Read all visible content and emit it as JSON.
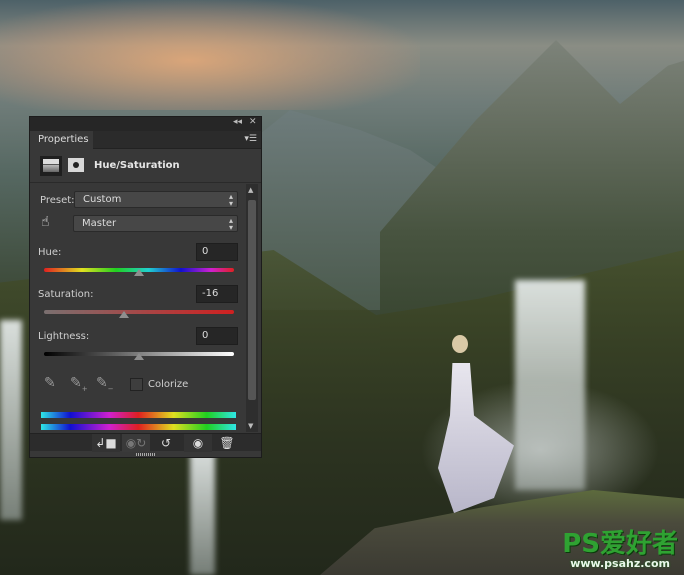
{
  "panel": {
    "tab_label": "Properties",
    "title": "Hue/Saturation",
    "preset_label": "Preset:",
    "preset_value": "Custom",
    "channel_value": "Master",
    "hue": {
      "label": "Hue:",
      "value": "0",
      "slider_fraction": 0.5
    },
    "saturation": {
      "label": "Saturation:",
      "value": "-16",
      "slider_fraction": 0.42
    },
    "lightness": {
      "label": "Lightness:",
      "value": "0",
      "slider_fraction": 0.5
    },
    "colorize_label": "Colorize",
    "colorize_checked": false,
    "icons": [
      "collapse-icon",
      "close-icon",
      "panel-menu-icon",
      "adjustment-layer-icon",
      "mask-icon",
      "targeted-adjustment-hand-icon",
      "eyedropper-icon",
      "eyedropper-add-icon",
      "eyedropper-subtract-icon",
      "clip-to-layer-icon",
      "view-previous-state-icon",
      "reset-icon",
      "visibility-icon",
      "delete-icon"
    ]
  },
  "watermark": {
    "logo": "PS爱好者",
    "url": "www.psahz.com"
  }
}
